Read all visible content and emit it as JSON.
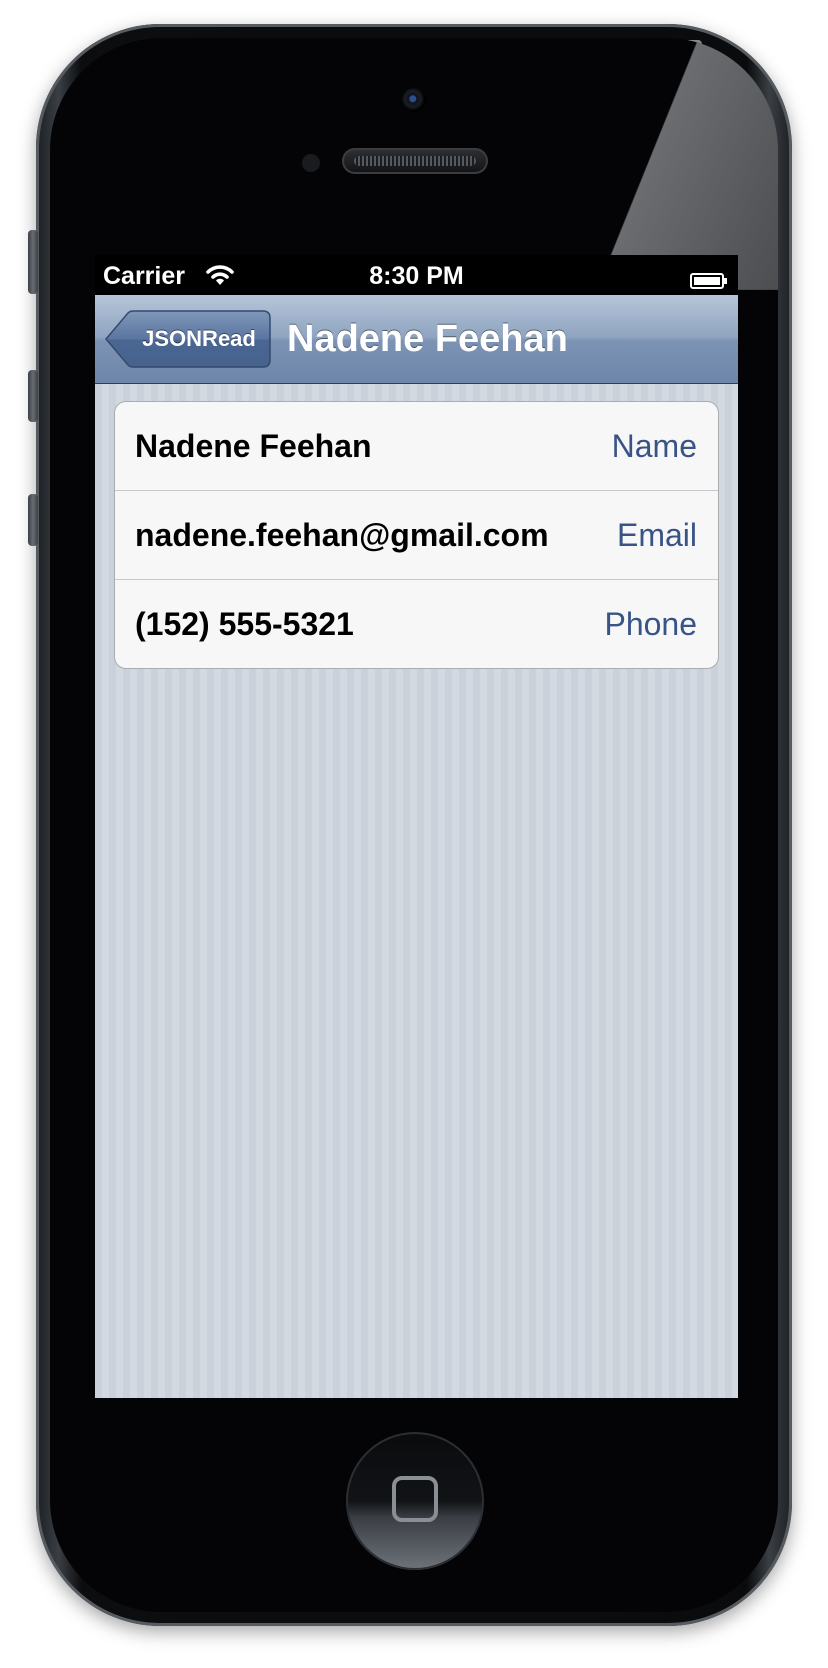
{
  "status_bar": {
    "carrier": "Carrier",
    "time": "8:30 PM",
    "wifi_icon": "wifi-icon",
    "battery_icon": "battery-icon"
  },
  "nav_bar": {
    "back_label": "JSONRead",
    "title": "Nadene Feehan"
  },
  "contact": {
    "rows": [
      {
        "value": "Nadene Feehan",
        "label": "Name"
      },
      {
        "value": "nadene.feehan@gmail.com",
        "label": "Email"
      },
      {
        "value": "(152) 555-5321",
        "label": "Phone"
      }
    ]
  },
  "colors": {
    "nav_bar": "#8fa4c0",
    "label_text": "#385487",
    "background": "#d0d5dd"
  }
}
